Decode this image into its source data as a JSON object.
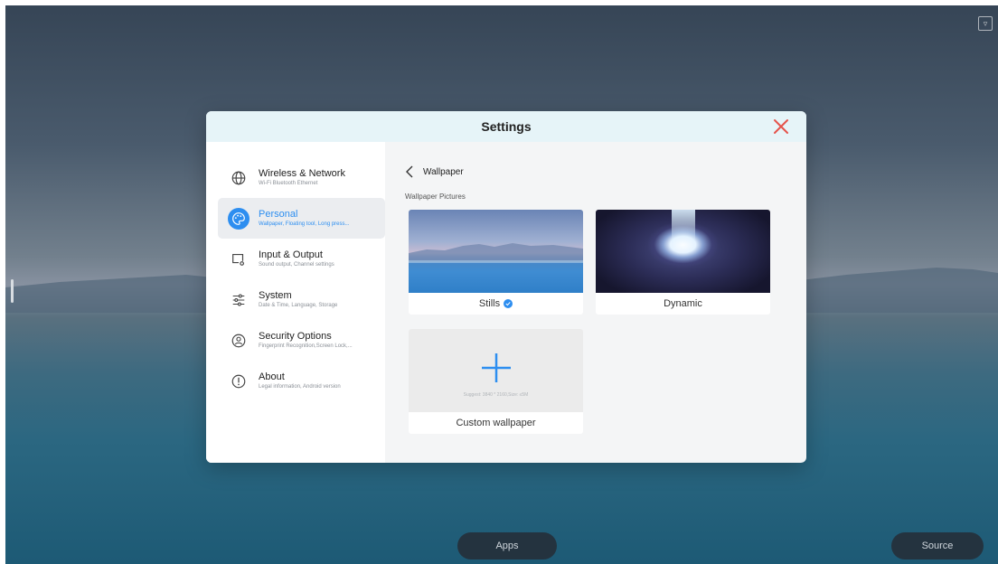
{
  "dialog": {
    "title": "Settings"
  },
  "sidebar": {
    "items": [
      {
        "label": "Wireless & Network",
        "sub": "Wi-Fi Bluetooth Ethernet",
        "icon": "globe-icon",
        "active": false
      },
      {
        "label": "Personal",
        "sub": "Wallpaper, Floating tool, Long press...",
        "icon": "palette-icon",
        "active": true
      },
      {
        "label": "Input & Output",
        "sub": "Sound output, Channel settings",
        "icon": "monitor-icon",
        "active": false
      },
      {
        "label": "System",
        "sub": "Date & Time, Language, Storage",
        "icon": "sliders-icon",
        "active": false
      },
      {
        "label": "Security Options",
        "sub": "Fingerprint Recognition,Screen Lock,...",
        "icon": "user-shield-icon",
        "active": false
      },
      {
        "label": "About",
        "sub": "Legal information, Android version",
        "icon": "info-icon",
        "active": false
      }
    ]
  },
  "content": {
    "back_label": "Wallpaper",
    "section_label": "Wallpaper Pictures",
    "cards": {
      "stills": "Stills",
      "dynamic": "Dynamic",
      "custom": "Custom wallpaper",
      "custom_hint": "Suggest: 3840 * 2160,Size: ≤5M"
    }
  },
  "taskbar": {
    "apps": "Apps",
    "source": "Source"
  },
  "colors": {
    "accent": "#2d8ef0",
    "close": "#e5534b",
    "header_bg": "#e6f4f8"
  }
}
